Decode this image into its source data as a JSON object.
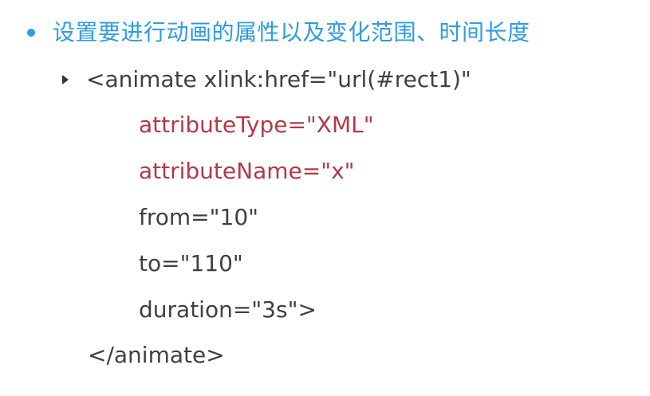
{
  "slide": {
    "heading": "设置要进行动画的属性以及变化范围、时间长度",
    "code_lines": [
      "<animate xlink:href=\"url(#rect1)\"",
      "attributeType=\"XML\"",
      "attributeName=\"x\"",
      "from=\"10\"",
      "to=\"110\"",
      "duration=\"3s\">",
      "</animate>"
    ],
    "icons": {
      "heading_bullet": "bullet-dot-icon",
      "sub_bullet": "triangle-right-icon"
    },
    "colors": {
      "heading": "#2f9be3",
      "code_default": "#404040",
      "code_accent": "#b23a48"
    }
  }
}
